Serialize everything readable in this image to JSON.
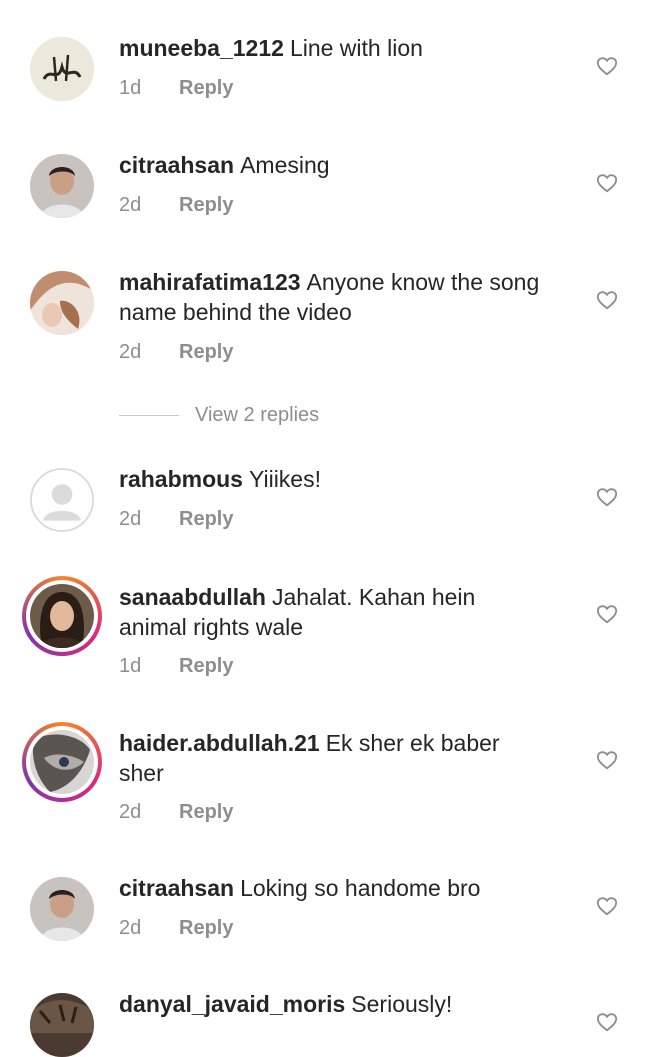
{
  "comments": [
    {
      "username": "muneeba_1212",
      "text": "Line with lion",
      "time": "1d",
      "reply": "Reply"
    },
    {
      "username": "citraahsan",
      "text": "Amesing",
      "time": "2d",
      "reply": "Reply"
    },
    {
      "username": "mahirafatima123",
      "text": "Anyone know the song name behind the video",
      "time": "2d",
      "reply": "Reply"
    },
    {
      "username": "rahabmous",
      "text": "Yiiikes!",
      "time": "2d",
      "reply": "Reply"
    },
    {
      "username": "sanaabdullah",
      "text": "Jahalat. Kahan hein animal rights wale",
      "time": "1d",
      "reply": "Reply"
    },
    {
      "username": "haider.abdullah.21",
      "text": "Ek sher ek baber sher",
      "time": "2d",
      "reply": "Reply"
    },
    {
      "username": "citraahsan",
      "text": "Loking so handome bro",
      "time": "2d",
      "reply": "Reply"
    },
    {
      "username": "danyal_javaid_moris",
      "text": "Seriously!"
    }
  ],
  "view_replies": "View 2 replies",
  "colors": {
    "secondary": "#8e8e8e",
    "primary": "#262626",
    "story_ring_start": "#f58529",
    "story_ring_end": "#dd2a7b"
  }
}
